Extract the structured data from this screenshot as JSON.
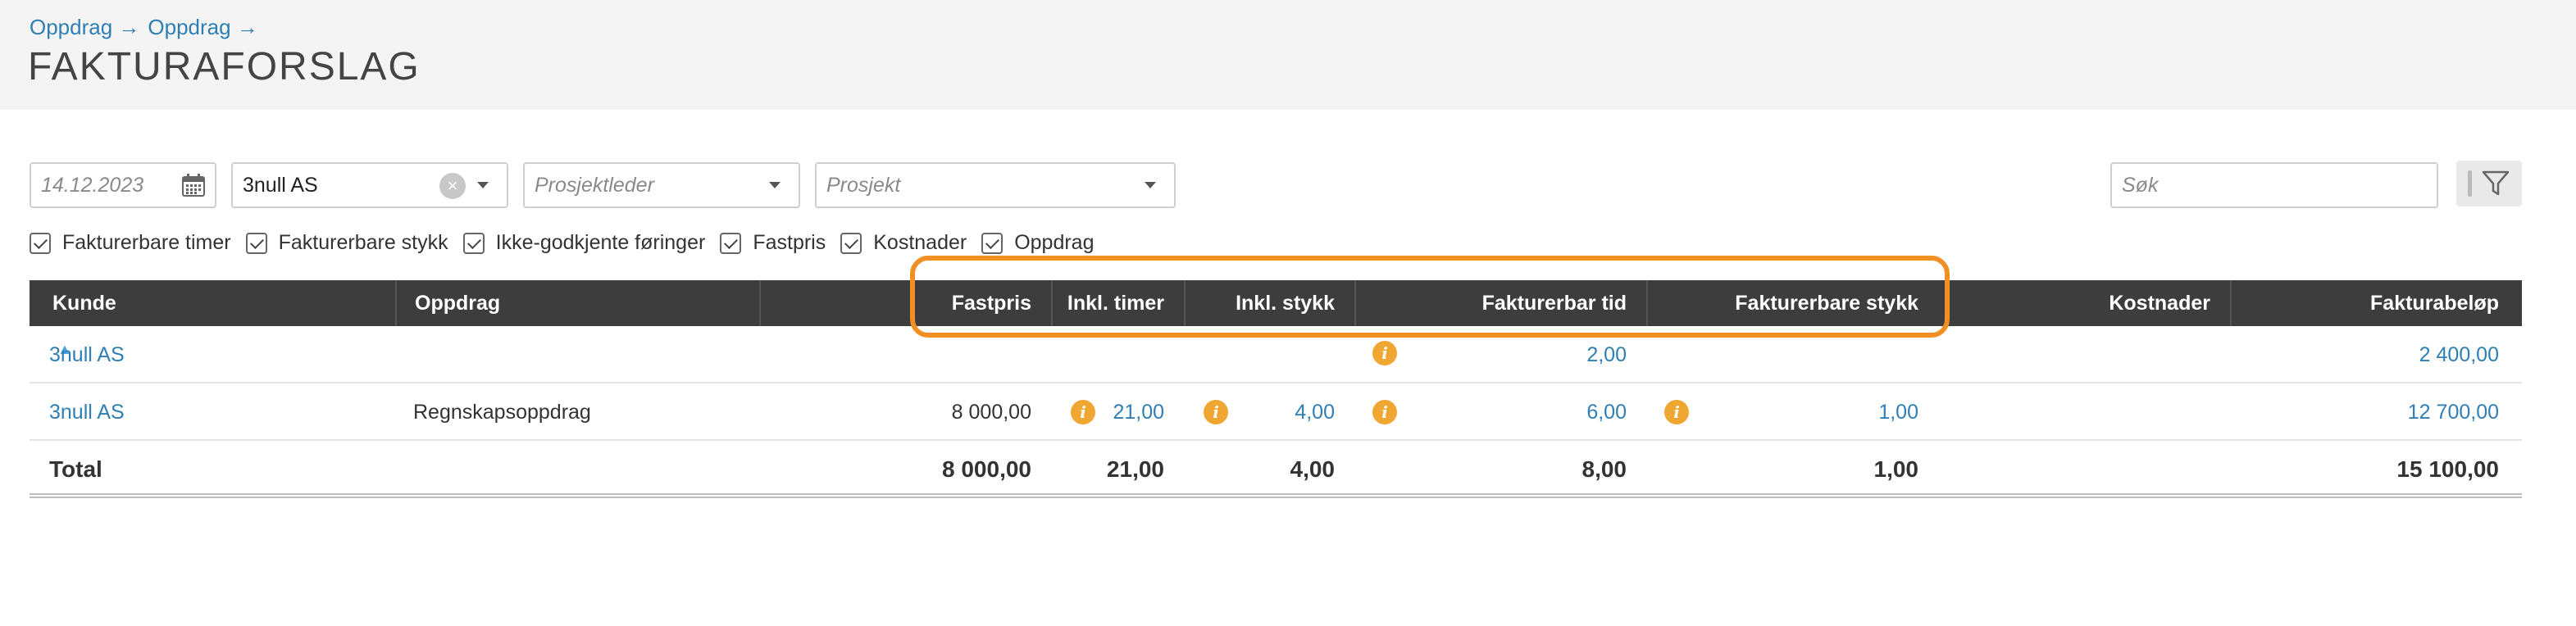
{
  "breadcrumb": {
    "item1": "Oppdrag →",
    "item2": "Oppdrag →"
  },
  "page": {
    "title": "FAKTURAFORSLAG"
  },
  "filters": {
    "date_placeholder": "14.12.2023",
    "customer_value": "3null AS",
    "project_manager_placeholder": "Prosjektleder",
    "project_placeholder": "Prosjekt",
    "search_placeholder": "Søk"
  },
  "checkboxes": [
    "Fakturerbare timer",
    "Fakturerbare stykk",
    "Ikke-godkjente føringer",
    "Fastpris",
    "Kostnader",
    "Oppdrag"
  ],
  "table": {
    "headers": {
      "kunde": "Kunde",
      "oppdrag": "Oppdrag",
      "fastpris": "Fastpris",
      "inkl_timer": "Inkl. timer",
      "inkl_stykk": "Inkl. stykk",
      "fakturerbar_tid": "Fakturerbar tid",
      "fakturerbare_stykk": "Fakturerbare stykk",
      "kostnader": "Kostnader",
      "fakturabelop": "Fakturabeløp"
    },
    "sort_indicator": "▲",
    "rows": [
      {
        "kunde": "3null AS",
        "oppdrag": "",
        "fastpris": "",
        "inkl_timer": "",
        "inkl_stykk": "",
        "fakturerbar_tid": "2,00",
        "fakturerbare_stykk": "",
        "kostnader": "",
        "fakturabelop": "2 400,00"
      },
      {
        "kunde": "3null AS",
        "oppdrag": "Regnskapsoppdrag",
        "fastpris": "8 000,00",
        "inkl_timer": "21,00",
        "inkl_stykk": "4,00",
        "fakturerbar_tid": "6,00",
        "fakturerbare_stykk": "1,00",
        "kostnader": "",
        "fakturabelop": "12 700,00"
      }
    ],
    "total": {
      "label": "Total",
      "fastpris": "8 000,00",
      "inkl_timer": "21,00",
      "inkl_stykk": "4,00",
      "fakturerbar_tid": "8,00",
      "fakturerbare_stykk": "1,00",
      "fakturabelop": "15 100,00"
    }
  },
  "icons": {
    "info": "i"
  },
  "colors": {
    "link": "#2f7fb5",
    "header_bg": "#3d3d3d",
    "info_icon": "#f0a731",
    "highlight": "#ef8f24"
  }
}
